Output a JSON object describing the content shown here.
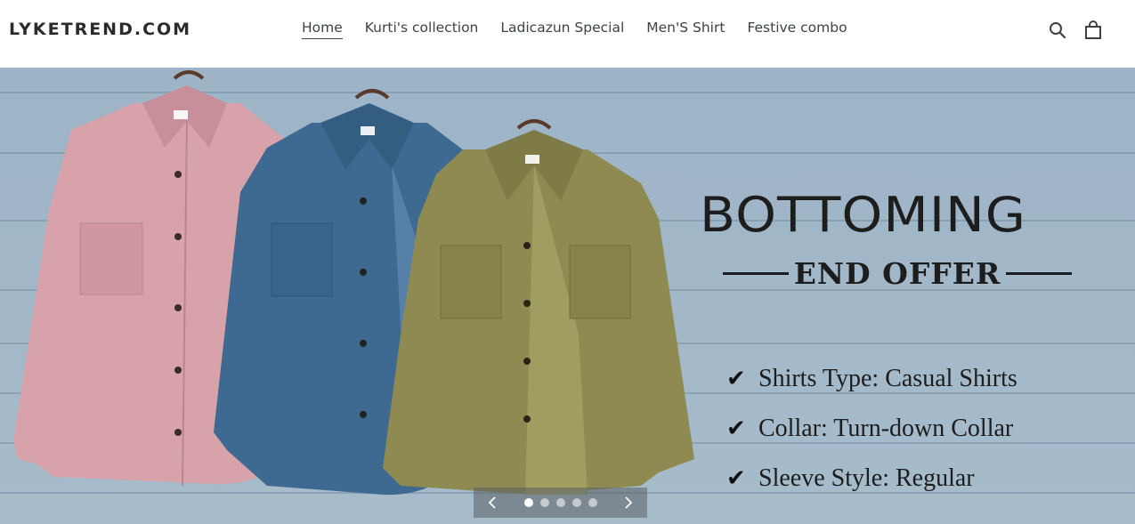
{
  "site": {
    "logo": "LYKETREND.COM"
  },
  "nav": [
    {
      "label": "Home",
      "active": true
    },
    {
      "label": "Kurti's collection",
      "active": false
    },
    {
      "label": "Ladicazun Special",
      "active": false
    },
    {
      "label": "Men'S Shirt",
      "active": false
    },
    {
      "label": "Festive combo",
      "active": false
    }
  ],
  "header_icons": {
    "search": "search-icon",
    "cart": "cart-icon"
  },
  "hero": {
    "headline": "BOTTOMING",
    "subline": "END OFFER",
    "features": [
      "Shirts Type: Casual Shirts",
      "Collar: Turn-down Collar",
      "Sleeve Style: Regular"
    ],
    "shirt_colors": [
      "#d9a3ab",
      "#3f6a91",
      "#8f8a52"
    ],
    "slides": {
      "count": 5,
      "active_index": 0
    }
  },
  "colors": {
    "hero_bg": "#9fb5c7",
    "text_dark": "#1d1d1d"
  }
}
